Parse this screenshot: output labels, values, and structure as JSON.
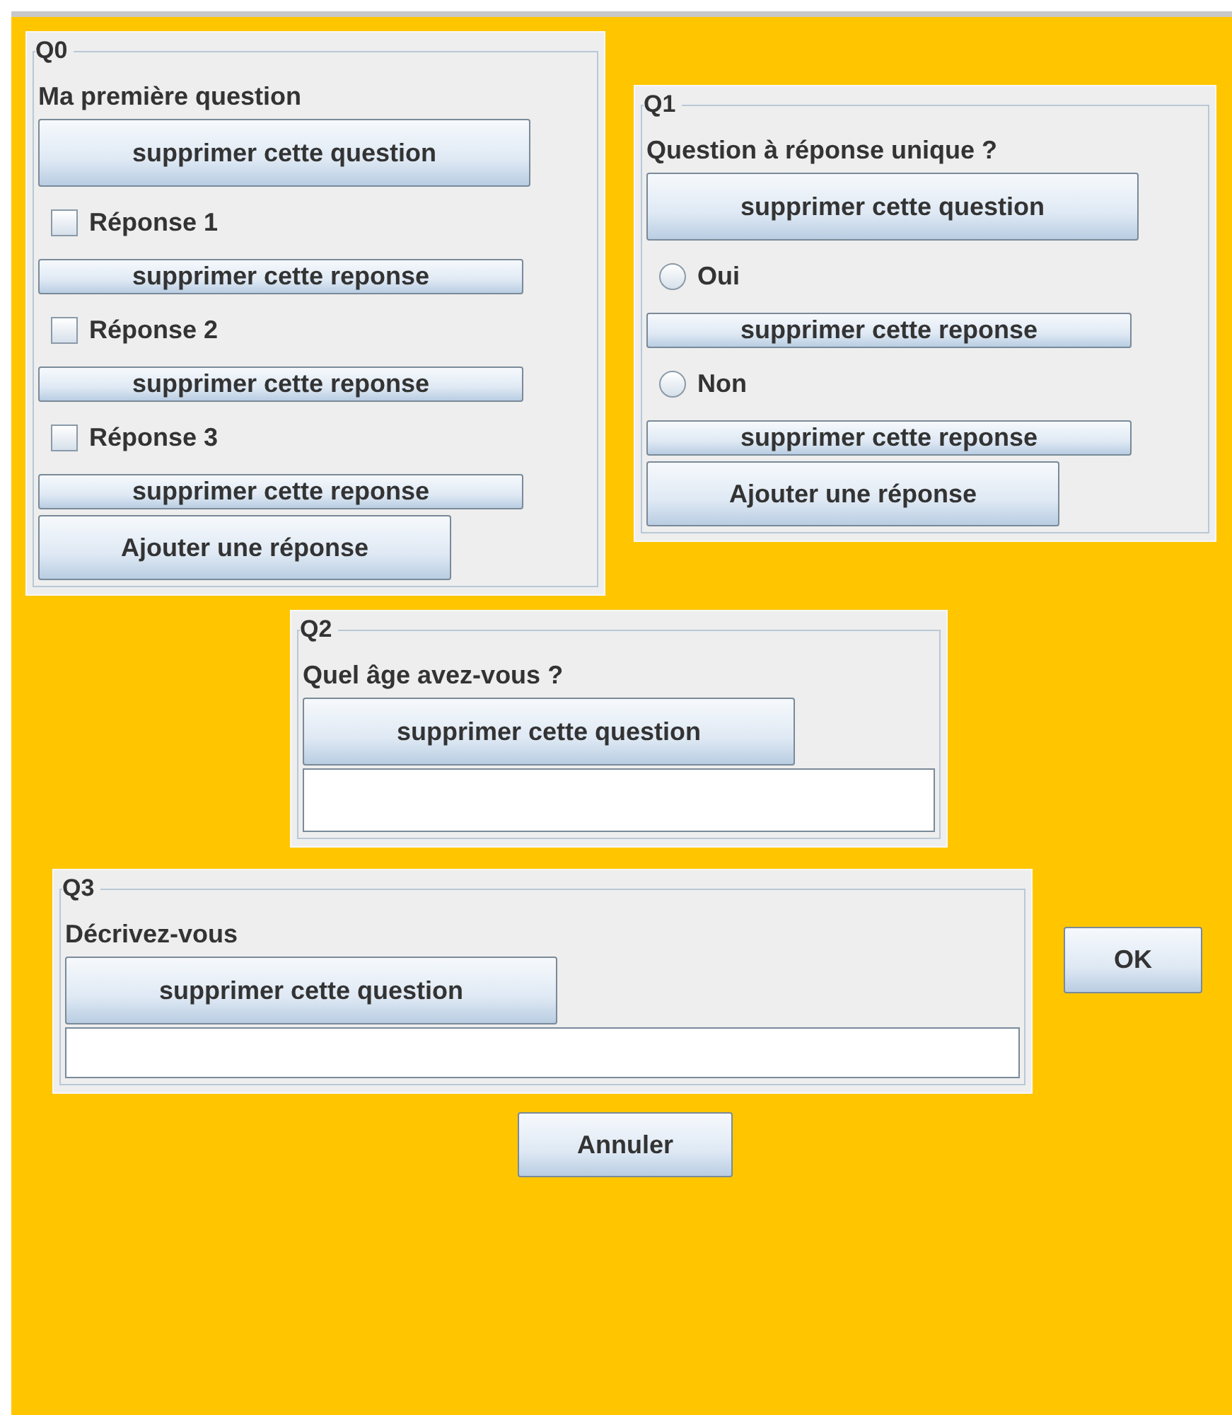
{
  "questions": [
    {
      "title": "Q0",
      "kind": "multiple",
      "text": "Ma première question",
      "delete_button": "supprimer cette question",
      "answers": [
        {
          "label": "Réponse 1",
          "checked": false,
          "delete_button": "supprimer cette reponse"
        },
        {
          "label": "Réponse 2",
          "checked": false,
          "delete_button": "supprimer cette reponse"
        },
        {
          "label": "Réponse 3",
          "checked": false,
          "delete_button": "supprimer cette reponse"
        }
      ],
      "add_button": "Ajouter une réponse"
    },
    {
      "title": "Q1",
      "kind": "single",
      "text": "Question à réponse unique ?",
      "delete_button": "supprimer cette question",
      "answers": [
        {
          "label": "Oui",
          "selected": false,
          "delete_button": "supprimer cette reponse"
        },
        {
          "label": "Non",
          "selected": false,
          "delete_button": "supprimer cette reponse"
        }
      ],
      "add_button": "Ajouter une réponse"
    },
    {
      "title": "Q2",
      "kind": "text",
      "text": "Quel âge avez-vous ?",
      "delete_button": "supprimer cette question"
    },
    {
      "title": "Q3",
      "kind": "text",
      "text": "Décrivez-vous",
      "delete_button": "supprimer cette question"
    }
  ],
  "ok_button": "OK",
  "cancel_button": "Annuler"
}
